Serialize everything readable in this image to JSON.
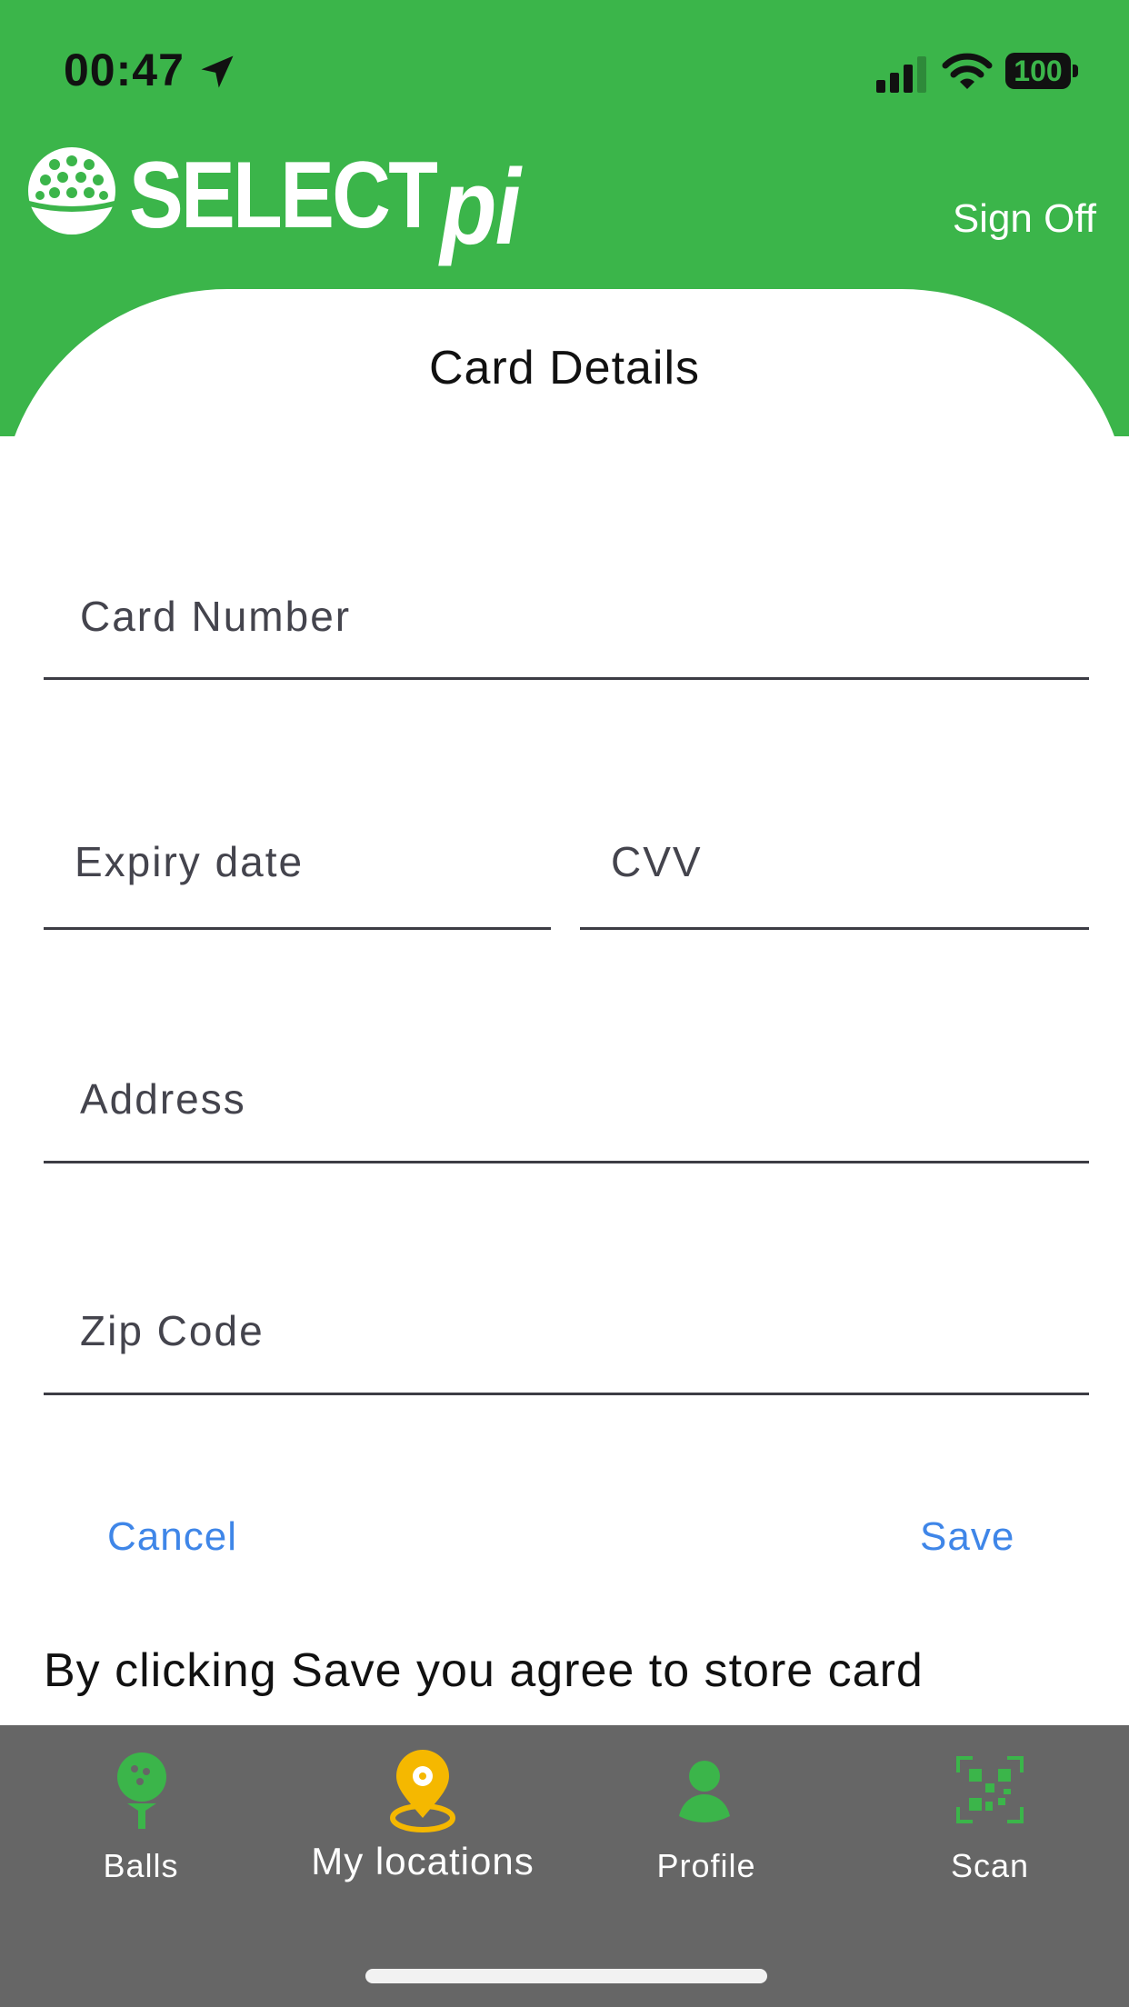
{
  "status_bar": {
    "time": "00:47",
    "battery": "100"
  },
  "header": {
    "brand": "SELECT",
    "brand_suffix": "pi",
    "sign_off": "Sign Off"
  },
  "form": {
    "title": "Card Details",
    "card_number": {
      "value": "",
      "placeholder": "Card Number"
    },
    "expiry_date": {
      "value": "",
      "placeholder": "Expiry date"
    },
    "cvv": {
      "value": "",
      "placeholder": "CVV"
    },
    "address": {
      "value": "",
      "placeholder": "Address"
    },
    "zip_code": {
      "value": "",
      "placeholder": "Zip Code"
    },
    "cancel": "Cancel",
    "save": "Save",
    "consent": "By clicking Save you agree to store card"
  },
  "tabs": [
    {
      "label": "Balls",
      "icon": "golf-ball-tee-icon"
    },
    {
      "label": "My locations",
      "icon": "location-pin-icon"
    },
    {
      "label": "Profile",
      "icon": "person-icon"
    },
    {
      "label": "Scan",
      "icon": "qr-scan-icon"
    }
  ],
  "colors": {
    "brand_green": "#3bb54a",
    "link_blue": "#3f86e8",
    "tabbar_gray": "#666666",
    "active_tab": "#f5b800"
  }
}
